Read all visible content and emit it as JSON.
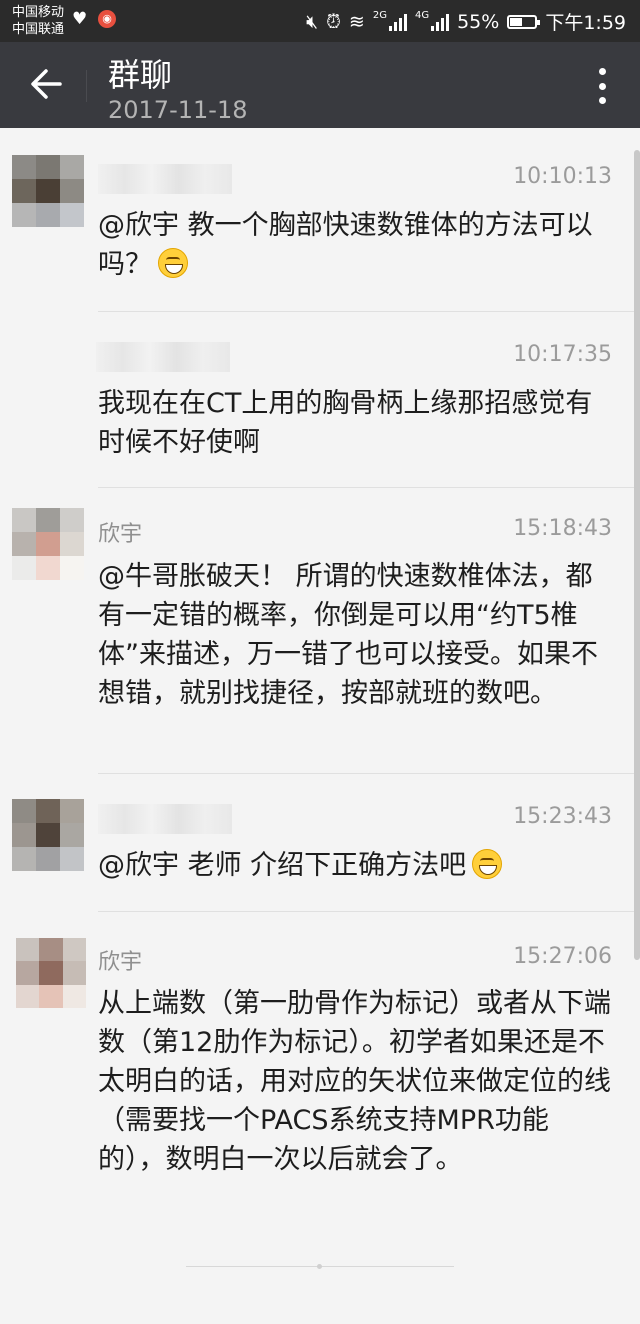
{
  "status_bar": {
    "carrier1": "中国移动",
    "carrier2": "中国联通",
    "net1": "2G",
    "net2": "4G",
    "battery": "55%",
    "battery_level": 0.55,
    "time": "下午1:59"
  },
  "header": {
    "title": "群聊",
    "date": "2017-11-18"
  },
  "messages": [
    {
      "name": "",
      "time": "10:10:13",
      "text": "@欣宇  教一个胸部快速数锥体的方法可以吗？",
      "emoji": "grinning-emoji"
    },
    {
      "name": "",
      "time": "10:17:35",
      "text": "我现在在CT上用的胸骨柄上缘那招感觉有时候不好使啊"
    },
    {
      "name": "欣宇",
      "time": "15:18:43",
      "text": "@牛哥胀破天！ 所谓的快速数椎体法，都有一定错的概率，你倒是可以用“约T5椎体”来描述，万一错了也可以接受。如果不想错，就别找捷径，按部就班的数吧。"
    },
    {
      "name": "",
      "time": "15:23:43",
      "text": "@欣宇 老师 介绍下正确方法吧",
      "emoji": "grinning-emoji"
    },
    {
      "name": "欣宇",
      "time": "15:27:06",
      "text": "从上端数（第一肋骨作为标记）或者从下端数（第12肋作为标记）。初学者如果还是不太明白的话，用对应的矢状位来做定位的线（需要找一个PACS系统支持MPR功能的），数明白一次以后就会了。"
    }
  ],
  "colors": {
    "status_bg": "#2b2b2b",
    "titlebar_bg": "#393a3f",
    "chat_bg": "#f4f4f4",
    "time_text": "#9b9b9b"
  }
}
